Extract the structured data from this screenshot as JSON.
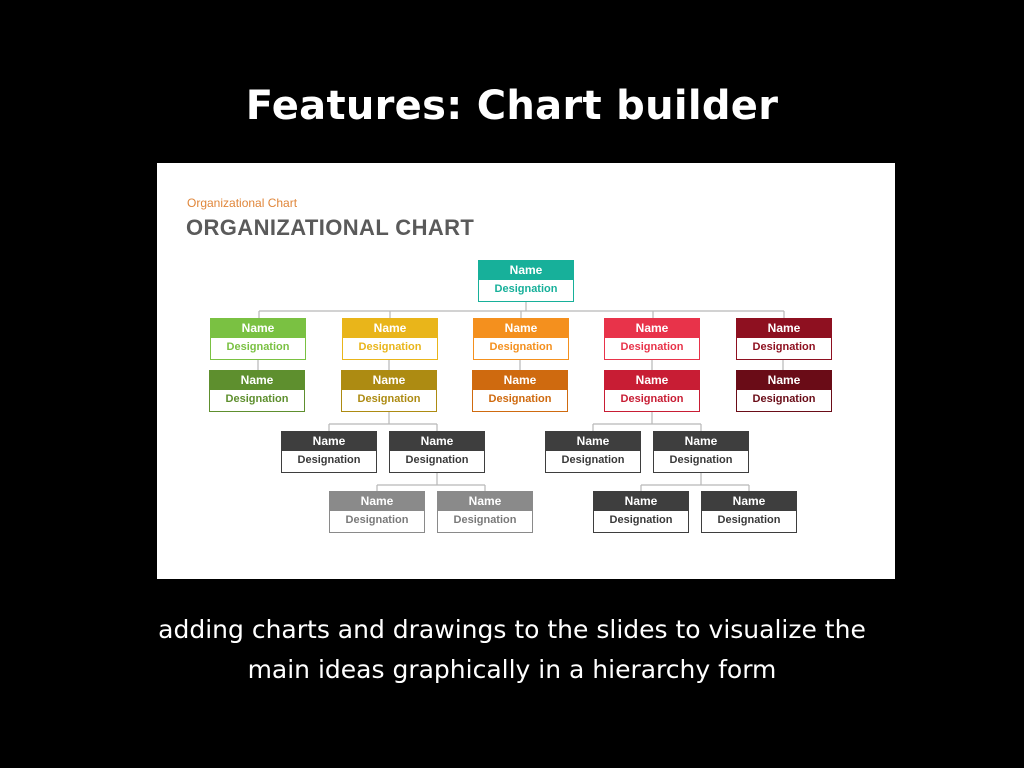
{
  "slide": {
    "title": "Features: Chart builder",
    "caption_line1": "adding charts and drawings to the slides to visualize the",
    "caption_line2": "main ideas graphically in a hierarchy form"
  },
  "org_chart": {
    "kicker": "Organizational Chart",
    "heading": "ORGANIZATIONAL CHART",
    "nodes": [
      {
        "id": "top",
        "name": "Name",
        "designation": "Designation",
        "color": "#17b09a"
      },
      {
        "id": "green-1",
        "name": "Name",
        "designation": "Designation",
        "color": "#7ac142"
      },
      {
        "id": "yellow-1",
        "name": "Name",
        "designation": "Designation",
        "color": "#e9b51a"
      },
      {
        "id": "orange-1",
        "name": "Name",
        "designation": "Designation",
        "color": "#f4901e"
      },
      {
        "id": "red-1",
        "name": "Name",
        "designation": "Designation",
        "color": "#e8334a"
      },
      {
        "id": "maroon-1",
        "name": "Name",
        "designation": "Designation",
        "color": "#8e1020"
      },
      {
        "id": "green-2",
        "name": "Name",
        "designation": "Designation",
        "color": "#5e8f2e"
      },
      {
        "id": "yellow-2",
        "name": "Name",
        "designation": "Designation",
        "color": "#ad8b12"
      },
      {
        "id": "orange-2",
        "name": "Name",
        "designation": "Designation",
        "color": "#cf6a0f"
      },
      {
        "id": "red-2",
        "name": "Name",
        "designation": "Designation",
        "color": "#c81d34"
      },
      {
        "id": "maroon-2",
        "name": "Name",
        "designation": "Designation",
        "color": "#6a0c17"
      },
      {
        "id": "gray-l1",
        "name": "Name",
        "designation": "Designation",
        "color": "#3e3e3e"
      },
      {
        "id": "gray-l2",
        "name": "Name",
        "designation": "Designation",
        "color": "#3e3e3e"
      },
      {
        "id": "gray-r1",
        "name": "Name",
        "designation": "Designation",
        "color": "#3e3e3e"
      },
      {
        "id": "gray-r2",
        "name": "Name",
        "designation": "Designation",
        "color": "#3e3e3e"
      },
      {
        "id": "light-l1",
        "name": "Name",
        "designation": "Designation",
        "color": "#8a8a8a"
      },
      {
        "id": "light-l2",
        "name": "Name",
        "designation": "Designation",
        "color": "#8a8a8a"
      },
      {
        "id": "dark-r1",
        "name": "Name",
        "designation": "Designation",
        "color": "#3e3e3e"
      },
      {
        "id": "dark-r2",
        "name": "Name",
        "designation": "Designation",
        "color": "#3e3e3e"
      }
    ]
  }
}
